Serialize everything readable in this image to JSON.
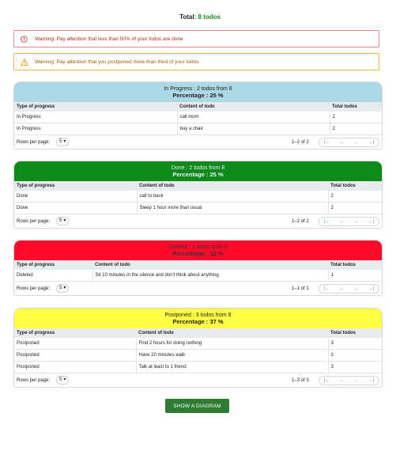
{
  "total": {
    "label": "Total:",
    "value": "8 todos"
  },
  "alerts": {
    "error": "Warning: Pay attention that less than 50% of your todos are done",
    "warn": "Warning: Pay attention that you postponed more than third of your todos"
  },
  "colors": {
    "in_progress": "#add8e6",
    "done": "#0e8a1a",
    "deleted": "#ff0a2a",
    "postponed": "#ffff45",
    "accent": "#2e7d32"
  },
  "groups": [
    {
      "title": "In Progress : 2 todos from 8",
      "percentage": "Percentage : 25 %",
      "headers": [
        "Type of progress",
        "Content of todo",
        "Total todos"
      ],
      "rows": [
        [
          "In Progress",
          "call mom",
          "2"
        ],
        [
          "In Progress",
          "buy a chair",
          "2"
        ]
      ],
      "rows_label": "Rows per page:",
      "rows_value": "5",
      "range": "1–2 of 2"
    },
    {
      "title": "Done : 2 todos from 8",
      "percentage": "Percentage : 25 %",
      "headers": [
        "Type of progress",
        "Content of todo",
        "Total todos"
      ],
      "rows": [
        [
          "Done",
          "call to back",
          "2"
        ],
        [
          "Done",
          "Sleep 1 hour more than usual",
          "2"
        ]
      ],
      "rows_label": "Rows per page:",
      "rows_value": "5",
      "range": "1–2 of 2"
    },
    {
      "title": "Deleted : 1 todos from 8",
      "percentage": "Percentage : 12 %",
      "headers": [
        "Type of progress",
        "Content of todo",
        "Total todos"
      ],
      "rows": [
        [
          "Deleted",
          "Sit 10 minutes in the silence and don't think about anything",
          "1"
        ]
      ],
      "rows_label": "Rows per page:",
      "rows_value": "5",
      "range": "1–1 of 1"
    },
    {
      "title": "Postponed : 3 todos from 8",
      "percentage": "Percentage : 37 %",
      "headers": [
        "Type of progress",
        "Content of todo",
        "Total todos"
      ],
      "rows": [
        [
          "Postponed",
          "Find 2 hours for doing nothing",
          "3"
        ],
        [
          "Postponed",
          "Have 20 minutes walk",
          "3"
        ],
        [
          "Postponed",
          "Talk at least to 1 friend",
          "3"
        ]
      ],
      "rows_label": "Rows per page:",
      "rows_value": "5",
      "range": "1–3 of 3"
    }
  ],
  "pager_icons": [
    "first-page-icon",
    "prev-page-icon",
    "next-page-icon",
    "last-page-icon"
  ],
  "button": "SHOW A DIAGRAM"
}
